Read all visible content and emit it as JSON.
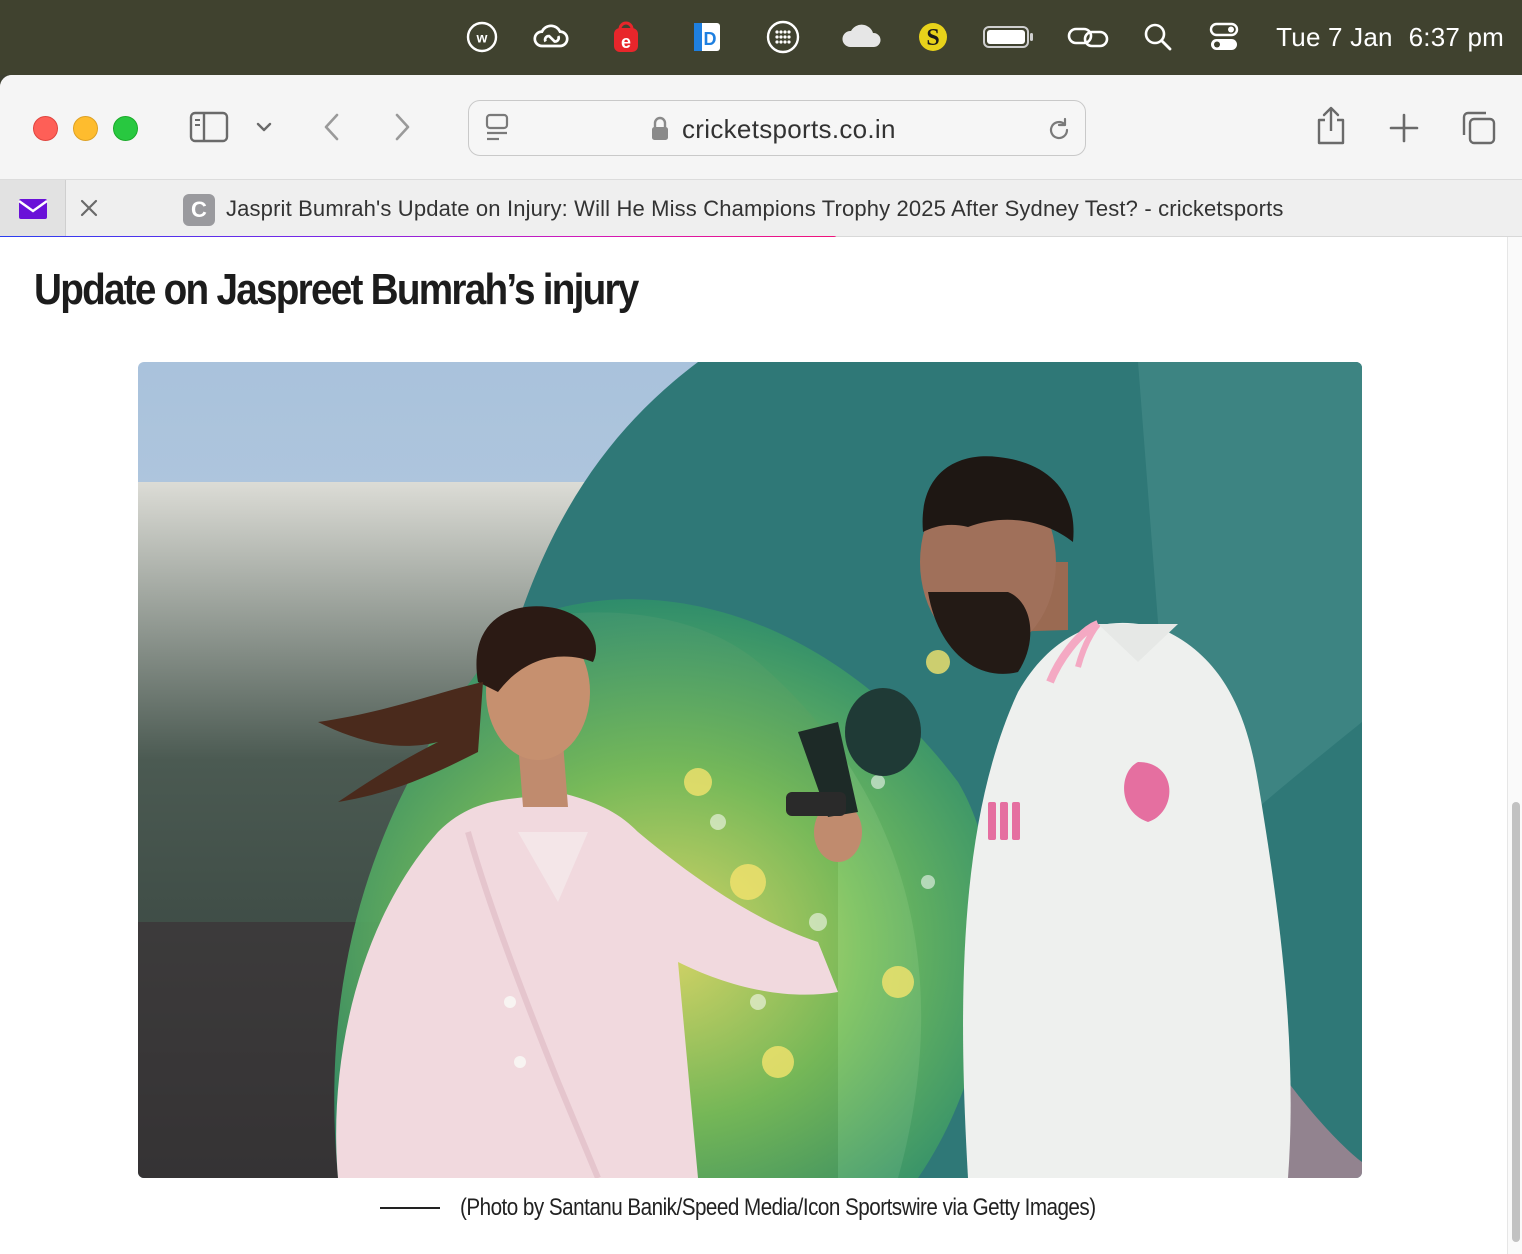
{
  "menubar": {
    "icons": [
      "whatsapp-web-icon",
      "creative-cloud-icon",
      "e-app-icon",
      "dictionary-app-icon",
      "grid-dots-icon",
      "onedrive-cloud-icon",
      "s-app-icon",
      "battery-icon",
      "link-icon",
      "spotlight-search-icon",
      "control-center-icon"
    ],
    "date": "Tue 7 Jan",
    "time": "6:37 pm"
  },
  "browser": {
    "url": "cricketsports.co.in",
    "tab": {
      "favicon_letter": "C",
      "title": "Jasprit Bumrah's Update on Injury: Will He Miss Champions Trophy 2025 After Sydney Test? - cricketsports"
    },
    "page_load_progress": 0.55
  },
  "article": {
    "heading": "Update on Jaspreet Bumrah’s injury",
    "image_caption": "(Photo by Santanu Banik/Speed Media/Icon Sportswire via Getty Images)"
  },
  "colors": {
    "menubar_bg": "#40422f",
    "close": "#fe5f57",
    "minimize": "#febc2e",
    "maximize": "#28c840",
    "progress_start": "#2a3df0",
    "progress_end": "#f0137a"
  }
}
